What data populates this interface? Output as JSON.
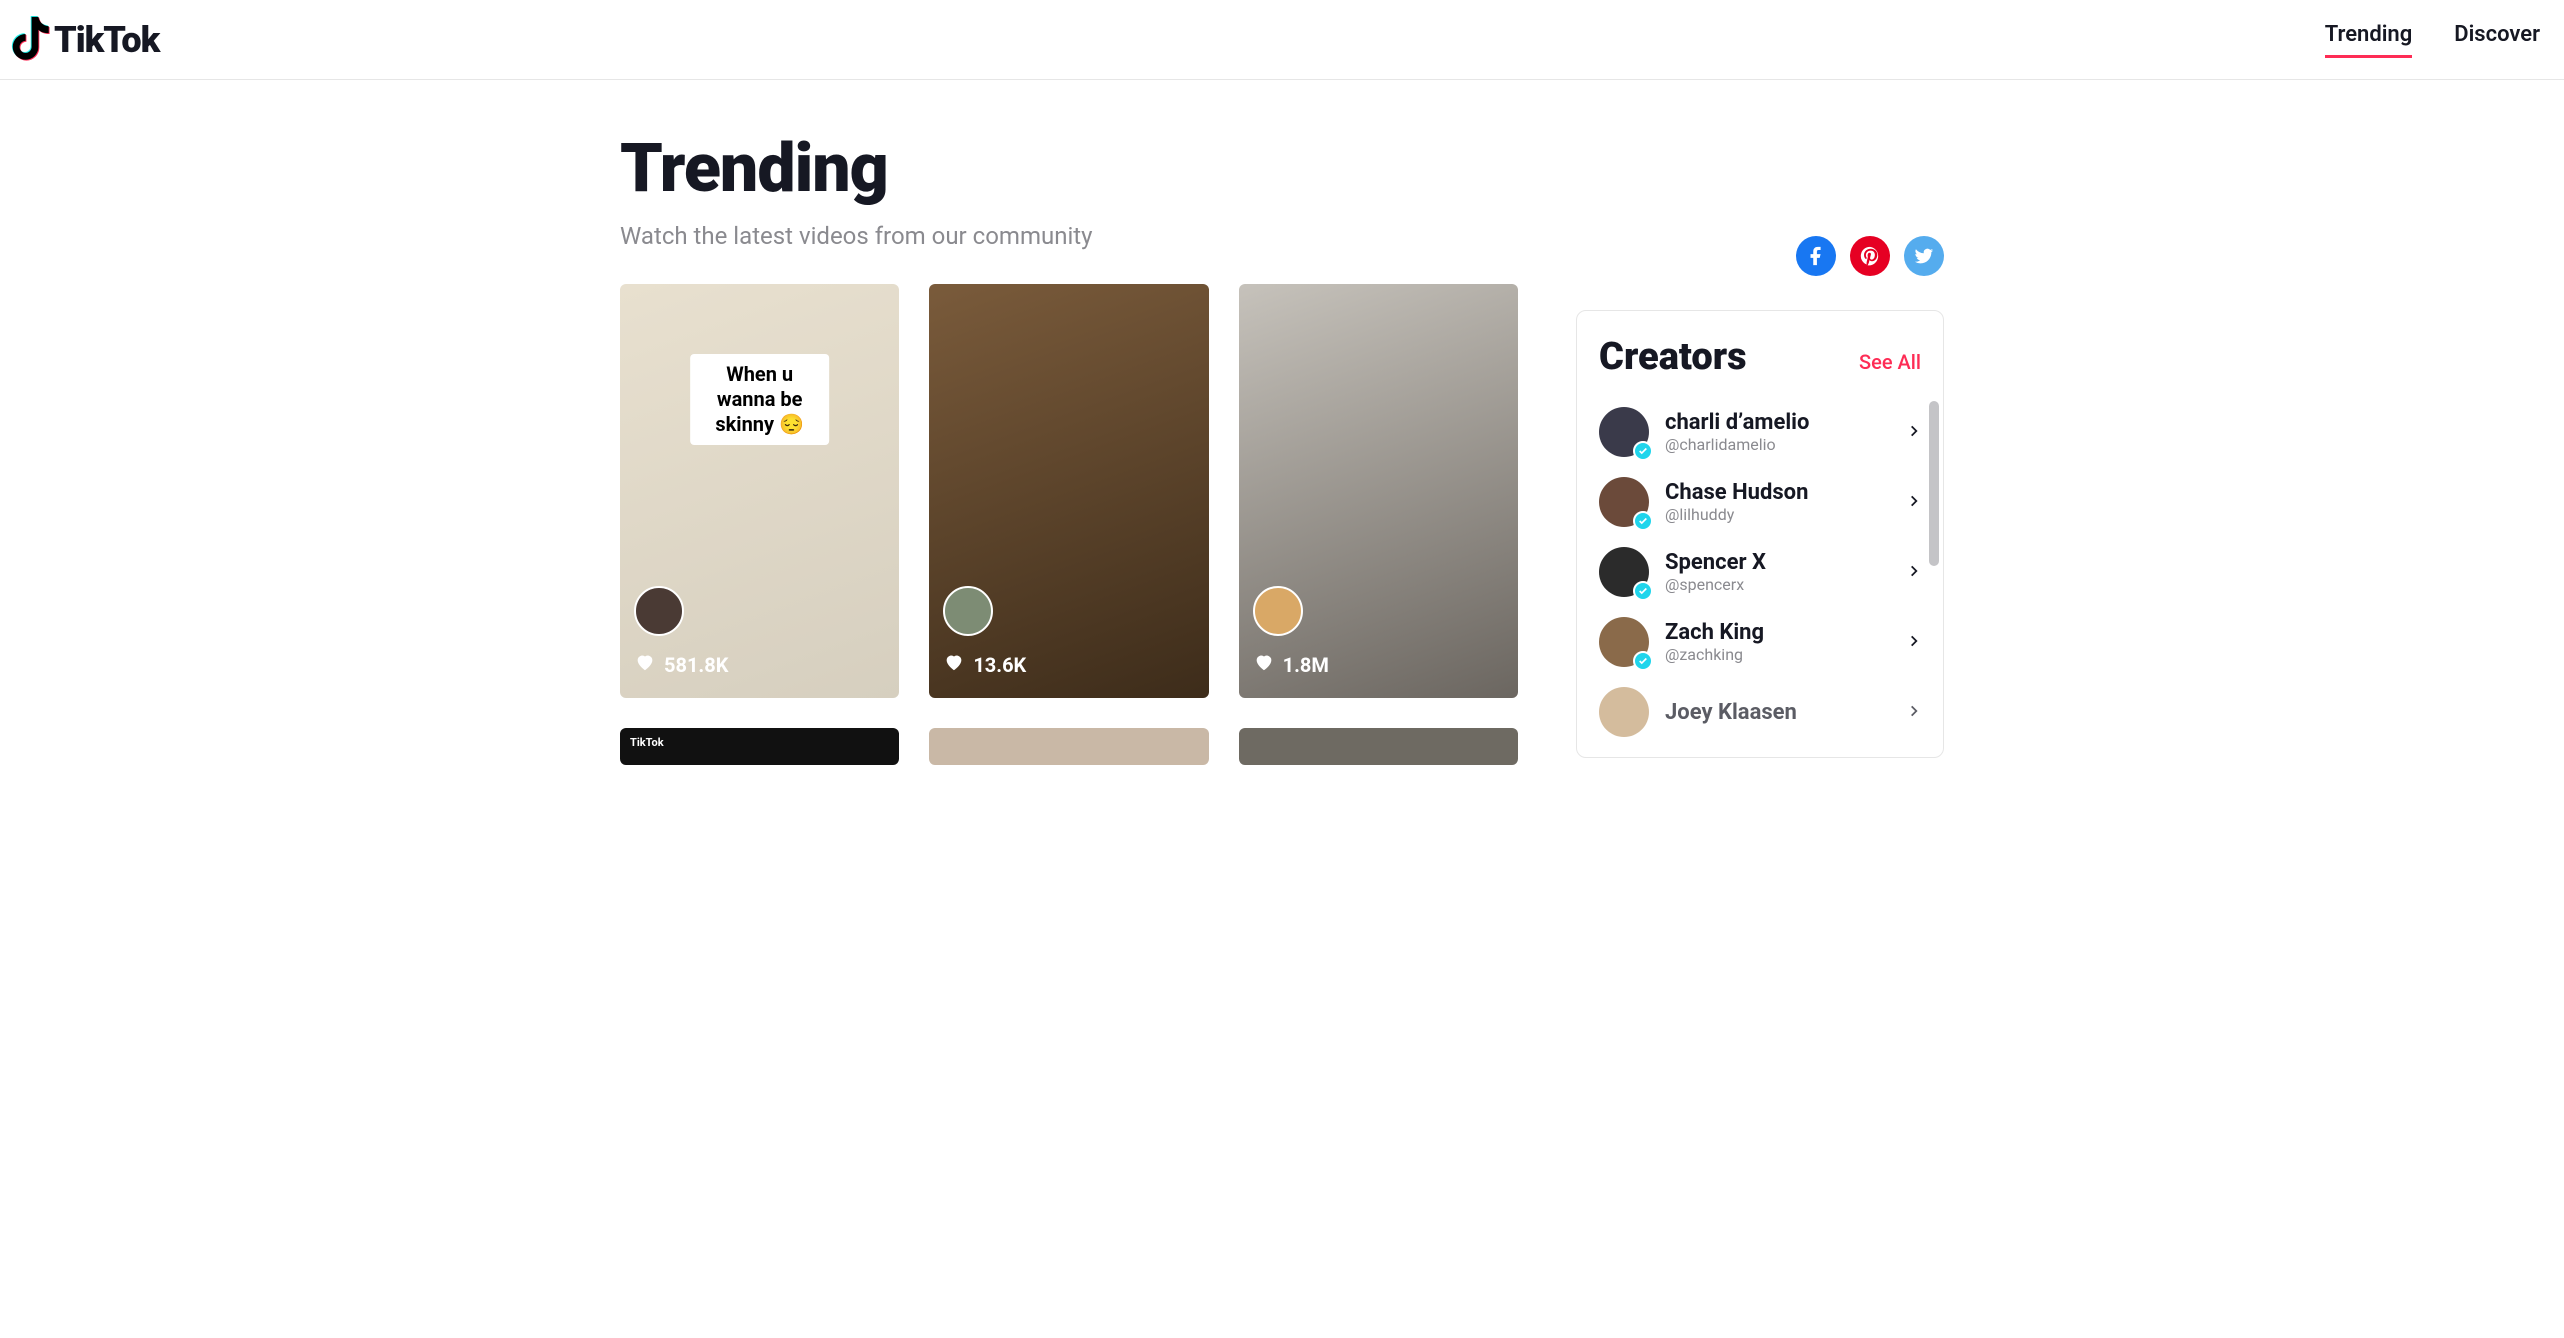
{
  "brand": "TikTok",
  "nav": {
    "items": [
      {
        "label": "Trending",
        "active": true
      },
      {
        "label": "Discover",
        "active": false
      }
    ]
  },
  "heading": {
    "title": "Trending",
    "subtitle": "Watch the latest videos from our community"
  },
  "share": {
    "facebook": "facebook-icon",
    "pinterest": "pinterest-icon",
    "twitter": "twitter-icon"
  },
  "videos": [
    {
      "caption": "When u wanna be\nskinny 😔",
      "likes": "581.8K"
    },
    {
      "caption": "",
      "likes": "13.6K"
    },
    {
      "caption": "",
      "likes": "1.8M"
    }
  ],
  "videos_row2_watermark": "TikTok",
  "creators": {
    "title": "Creators",
    "see_all": "See All",
    "list": [
      {
        "name": "charli d’amelio",
        "handle": "@charlidamelio",
        "verified": true
      },
      {
        "name": "Chase Hudson",
        "handle": "@lilhuddy",
        "verified": true
      },
      {
        "name": "Spencer X",
        "handle": "@spencerx",
        "verified": true
      },
      {
        "name": "Zach King",
        "handle": "@zachking",
        "verified": true
      },
      {
        "name": "Joey Klaasen",
        "handle": "",
        "verified": false
      }
    ]
  }
}
